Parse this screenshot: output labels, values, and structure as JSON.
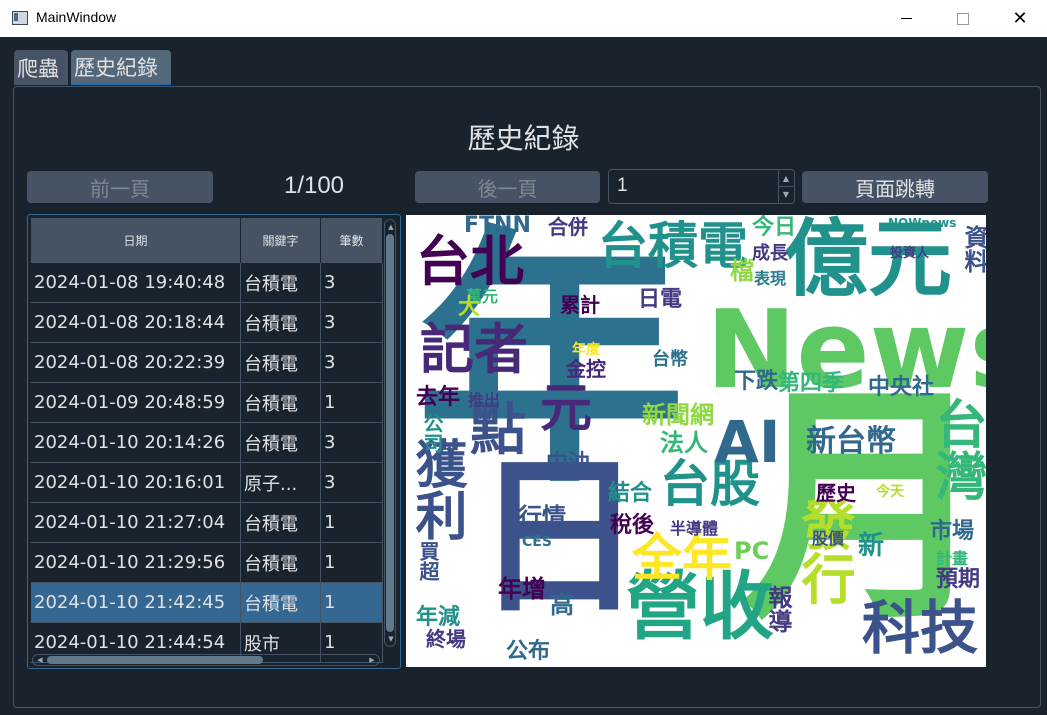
{
  "window": {
    "title": "MainWindow",
    "min": "—",
    "max": "",
    "close": "✕"
  },
  "tabs": [
    {
      "label": "爬蟲"
    },
    {
      "label": "歷史紀錄"
    }
  ],
  "heading": "歷史紀錄",
  "controls": {
    "prev_label": "前一頁",
    "page_indicator": "1/100",
    "next_label": "後一頁",
    "page_input": "1",
    "jump_label": "頁面跳轉"
  },
  "table": {
    "headers": [
      "日期",
      "關鍵字",
      "筆數"
    ],
    "rows": [
      {
        "date": "2024-01-08 19:40:48",
        "keyword": "台積電",
        "count": "3"
      },
      {
        "date": "2024-01-08 20:18:44",
        "keyword": "台積電",
        "count": "3"
      },
      {
        "date": "2024-01-08 20:22:39",
        "keyword": "台積電",
        "count": "3"
      },
      {
        "date": "2024-01-09 20:48:59",
        "keyword": "台積電",
        "count": "1"
      },
      {
        "date": "2024-01-10 20:14:26",
        "keyword": "台積電",
        "count": "3"
      },
      {
        "date": "2024-01-10 20:16:01",
        "keyword": "原子...",
        "count": "3"
      },
      {
        "date": "2024-01-10 21:27:04",
        "keyword": "台積電",
        "count": "1"
      },
      {
        "date": "2024-01-10 21:29:56",
        "keyword": "台積電",
        "count": "1"
      },
      {
        "date": "2024-01-10 21:42:45",
        "keyword": "台積電",
        "count": "1"
      },
      {
        "date": "2024-01-10 21:44:54",
        "keyword": "股市",
        "count": "1"
      }
    ],
    "selected_index": 8
  },
  "wordcloud": {
    "words": [
      {
        "text": "年",
        "color": "#2c728e"
      },
      {
        "text": "月",
        "color": "#5ec962"
      },
      {
        "text": "News",
        "color": "#5ec962"
      },
      {
        "text": "億元",
        "color": "#21918c"
      },
      {
        "text": "日",
        "color": "#3b528b"
      },
      {
        "text": "台積電",
        "color": "#21918c"
      },
      {
        "text": "台北",
        "color": "#440154"
      },
      {
        "text": "記者",
        "color": "#482878"
      },
      {
        "text": "營收",
        "color": "#21a585"
      },
      {
        "text": "科技",
        "color": "#3b528b"
      },
      {
        "text": "台股",
        "color": "#21918c"
      },
      {
        "text": "全年",
        "color": "#fde725"
      },
      {
        "text": "AI",
        "color": "#31688e"
      },
      {
        "text": "點",
        "color": "#3b528b"
      },
      {
        "text": "元",
        "color": "#482878"
      },
      {
        "text": "獲利",
        "color": "#3b528b"
      },
      {
        "text": "發行",
        "color": "#b5de2b"
      },
      {
        "text": "台灣",
        "color": "#35b779"
      },
      {
        "text": "新台幣",
        "color": "#31688e"
      },
      {
        "text": "FTNN",
        "color": "#31688e"
      },
      {
        "text": "合併",
        "color": "#443983"
      },
      {
        "text": "今日",
        "color": "#35b779"
      },
      {
        "text": "成長",
        "color": "#443983"
      },
      {
        "text": "檔",
        "color": "#90d743"
      },
      {
        "text": "表現",
        "color": "#287c8e"
      },
      {
        "text": "投資人",
        "color": "#443983"
      },
      {
        "text": "NOWnews",
        "color": "#21918c"
      },
      {
        "text": "資料",
        "color": "#3b528b"
      },
      {
        "text": "累計",
        "color": "#440154"
      },
      {
        "text": "日電",
        "color": "#443983"
      },
      {
        "text": "萬元",
        "color": "#35b779"
      },
      {
        "text": "台幣",
        "color": "#2c728e"
      },
      {
        "text": "金控",
        "color": "#482878"
      },
      {
        "text": "年度",
        "color": "#fde725"
      },
      {
        "text": "下跌",
        "color": "#31688e"
      },
      {
        "text": "第四季",
        "color": "#35b779"
      },
      {
        "text": "中央社",
        "color": "#31688e"
      },
      {
        "text": "去年",
        "color": "#440154"
      },
      {
        "text": "推出",
        "color": "#443983"
      },
      {
        "text": "新聞網",
        "color": "#90d743"
      },
      {
        "text": "法人",
        "color": "#35b779"
      },
      {
        "text": "公司",
        "color": "#21918c"
      },
      {
        "text": "中油",
        "color": "#3b528b"
      },
      {
        "text": "結合",
        "color": "#21918c"
      },
      {
        "text": "行情",
        "color": "#3b528b"
      },
      {
        "text": "稅後",
        "color": "#440154"
      },
      {
        "text": "半導體",
        "color": "#443983"
      },
      {
        "text": "PC",
        "color": "#6ece58"
      },
      {
        "text": "歷史",
        "color": "#440154"
      },
      {
        "text": "今天",
        "color": "#b5de2b"
      },
      {
        "text": "市場",
        "color": "#31688e"
      },
      {
        "text": "計畫",
        "color": "#35b779"
      },
      {
        "text": "預期",
        "color": "#443983"
      },
      {
        "text": "股價",
        "color": "#3b528b"
      },
      {
        "text": "新",
        "color": "#21918c"
      },
      {
        "text": "報導",
        "color": "#443983"
      },
      {
        "text": "年增",
        "color": "#440154"
      },
      {
        "text": "高",
        "color": "#31688e"
      },
      {
        "text": "年減",
        "color": "#21918c"
      },
      {
        "text": "買超",
        "color": "#3b528b"
      },
      {
        "text": "終場",
        "color": "#443983"
      },
      {
        "text": "公布",
        "color": "#31688e"
      },
      {
        "text": "CES",
        "color": "#2c728e"
      },
      {
        "text": "大",
        "color": "#b5de2b"
      }
    ]
  }
}
